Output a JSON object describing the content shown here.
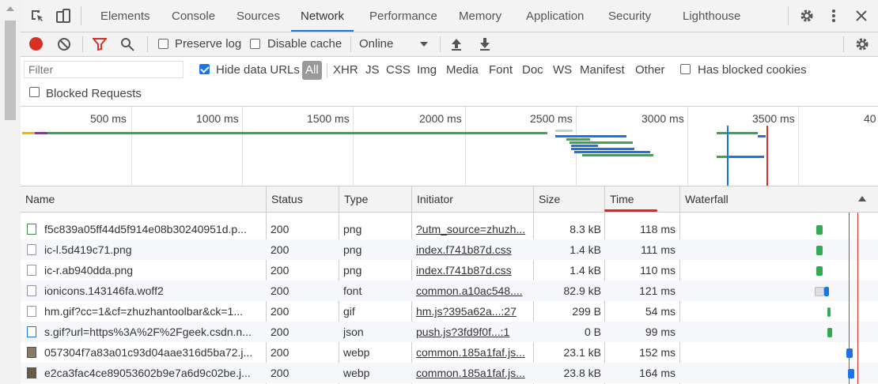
{
  "tabs": [
    "Elements",
    "Console",
    "Sources",
    "Network",
    "Performance",
    "Memory",
    "Application",
    "Security",
    "Lighthouse"
  ],
  "active_tab": "Network",
  "toolbar": {
    "preserve_log": "Preserve log",
    "disable_cache": "Disable cache",
    "throttle": "Online"
  },
  "filter": {
    "placeholder": "Filter",
    "hide_data_urls": "Hide data URLs",
    "types": [
      "All",
      "XHR",
      "JS",
      "CSS",
      "Img",
      "Media",
      "Font",
      "Doc",
      "WS",
      "Manifest",
      "Other"
    ],
    "has_blocked_cookies": "Has blocked cookies",
    "blocked_requests": "Blocked Requests"
  },
  "overview": {
    "ticks": [
      "500 ms",
      "1000 ms",
      "1500 ms",
      "2000 ms",
      "2500 ms",
      "3000 ms",
      "3500 ms",
      "40"
    ]
  },
  "columns": [
    "Name",
    "Status",
    "Type",
    "Initiator",
    "Size",
    "Time",
    "Waterfall"
  ],
  "rows": [
    {
      "name": "f5c839a05ff44d5f914e08b30240951d.p...",
      "status": "200",
      "type": "png",
      "initiator": "?utm_source=zhuzh...",
      "size": "8.3 kB",
      "time": "118 ms"
    },
    {
      "name": "ic-l.5d419c71.png",
      "status": "200",
      "type": "png",
      "initiator": "index.f741b87d.css",
      "size": "1.4 kB",
      "time": "111 ms"
    },
    {
      "name": "ic-r.ab940dda.png",
      "status": "200",
      "type": "png",
      "initiator": "index.f741b87d.css",
      "size": "1.4 kB",
      "time": "110 ms"
    },
    {
      "name": "ionicons.143146fa.woff2",
      "status": "200",
      "type": "font",
      "initiator": "common.a10ac548....",
      "size": "82.9 kB",
      "time": "121 ms"
    },
    {
      "name": "hm.gif?cc=1&cf=zhuzhantoolbar&ck=1...",
      "status": "200",
      "type": "gif",
      "initiator": "hm.js?395a62a...:27",
      "size": "299 B",
      "time": "54 ms"
    },
    {
      "name": "s.gif?url=https%3A%2F%2Fgeek.csdn.n...",
      "status": "200",
      "type": "json",
      "initiator": "push.js?3fd9f0f...:1",
      "size": "0 B",
      "time": "99 ms"
    },
    {
      "name": "057304f7a83a01c93d04aae316d5ba72.j...",
      "status": "200",
      "type": "webp",
      "initiator": "common.185a1faf.js...",
      "size": "23.1 kB",
      "time": "152 ms"
    },
    {
      "name": "e2ca3fac4ce89053602b9e7a6d9c02be.j...",
      "status": "200",
      "type": "webp",
      "initiator": "common.185a1faf.js...",
      "size": "23.8 kB",
      "time": "164 ms"
    }
  ],
  "colors": {
    "accent": "#1a73e8",
    "record": "#d93025",
    "sort_underline": "#e8231b"
  }
}
